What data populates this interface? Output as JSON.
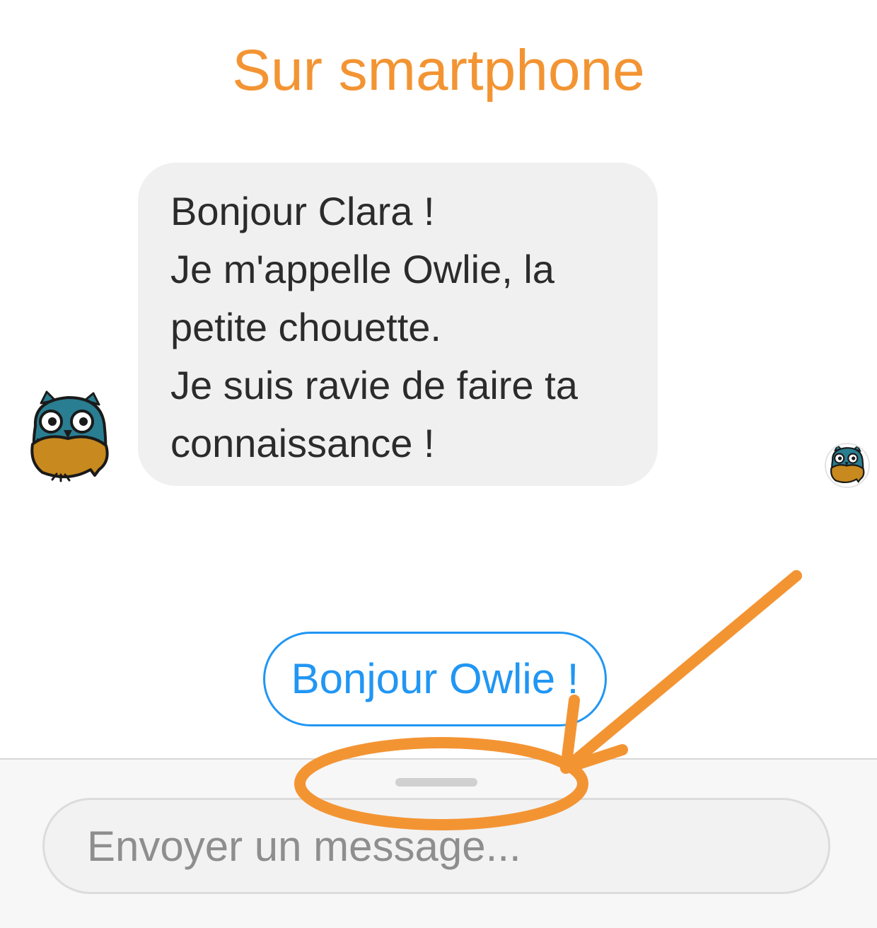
{
  "header": {
    "title": "Sur smartphone"
  },
  "chat": {
    "bot_avatar_icon": "owl-icon",
    "user_avatar_icon": "owl-icon",
    "bot_message_lines": [
      "Bonjour Clara !",
      "Je m'appelle Owlie, la",
      "petite chouette.",
      "Je suis ravie de faire ta",
      "connaissance !"
    ]
  },
  "quick_reply": {
    "label": "Bonjour Owlie !"
  },
  "composer": {
    "placeholder": "Envoyer un message...",
    "value": ""
  },
  "colors": {
    "title": "#f39433",
    "annotation": "#f39433",
    "bubble_background": "#f0f0f0",
    "quick_reply_accent": "#2196f3",
    "owl_head": "#2a7e91",
    "owl_body": "#c8891e"
  }
}
